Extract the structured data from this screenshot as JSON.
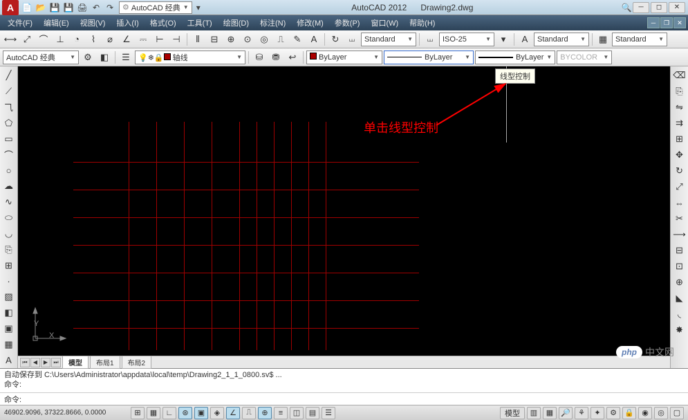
{
  "app": {
    "logo_letter": "A",
    "name": "AutoCAD 2012",
    "document": "Drawing2.dwg",
    "workspace_selector": "AutoCAD 经典"
  },
  "qat_icons": [
    "new-icon",
    "open-icon",
    "save-icon",
    "saveas-icon",
    "print-icon",
    "undo-icon",
    "redo-icon"
  ],
  "menu": [
    "文件(F)",
    "编辑(E)",
    "视图(V)",
    "插入(I)",
    "格式(O)",
    "工具(T)",
    "绘图(D)",
    "标注(N)",
    "修改(M)",
    "参数(P)",
    "窗口(W)",
    "帮助(H)"
  ],
  "toolbar1": {
    "dim_style": "Standard",
    "dim_iso": "ISO-25",
    "text_style": "Standard",
    "table_style": "Standard"
  },
  "toolbar2": {
    "workspace": "AutoCAD 经典",
    "layer_name": "轴线",
    "layer_display": "ByLayer",
    "linetype": "ByLayer",
    "lineweight": "ByLayer",
    "plot_style": "BYCOLOR"
  },
  "annotation_text": "单击线型控制",
  "tooltip_text": "线型控制",
  "ucs": {
    "y_label": "Y",
    "x_label": "X"
  },
  "tabs": {
    "model": "模型",
    "layout1": "布局1",
    "layout2": "布局2"
  },
  "command": {
    "line1": "自动保存到 C:\\Users\\Administrator\\appdata\\local\\temp\\Drawing2_1_1_0800.sv$ ...",
    "line2": "命令:",
    "prompt": "命令:"
  },
  "status": {
    "coords": "46902.9096, 37322.8666, 0.0000",
    "model_text": "模型"
  },
  "watermark": {
    "badge": "php",
    "text": "中文网"
  },
  "left_tool_names": [
    "line",
    "const-line",
    "polyline",
    "polygon",
    "rectangle",
    "arc",
    "circle",
    "rev-cloud",
    "spline",
    "ellipse",
    "ellipse-arc",
    "insert-block",
    "make-block",
    "point",
    "hatch",
    "gradient",
    "region",
    "table",
    "text"
  ],
  "right_tool_names": [
    "erase",
    "copy",
    "mirror",
    "offset",
    "array",
    "move",
    "rotate",
    "scale",
    "stretch",
    "trim",
    "extend",
    "break-pt",
    "break",
    "join",
    "chamfer",
    "fillet",
    "explode"
  ]
}
